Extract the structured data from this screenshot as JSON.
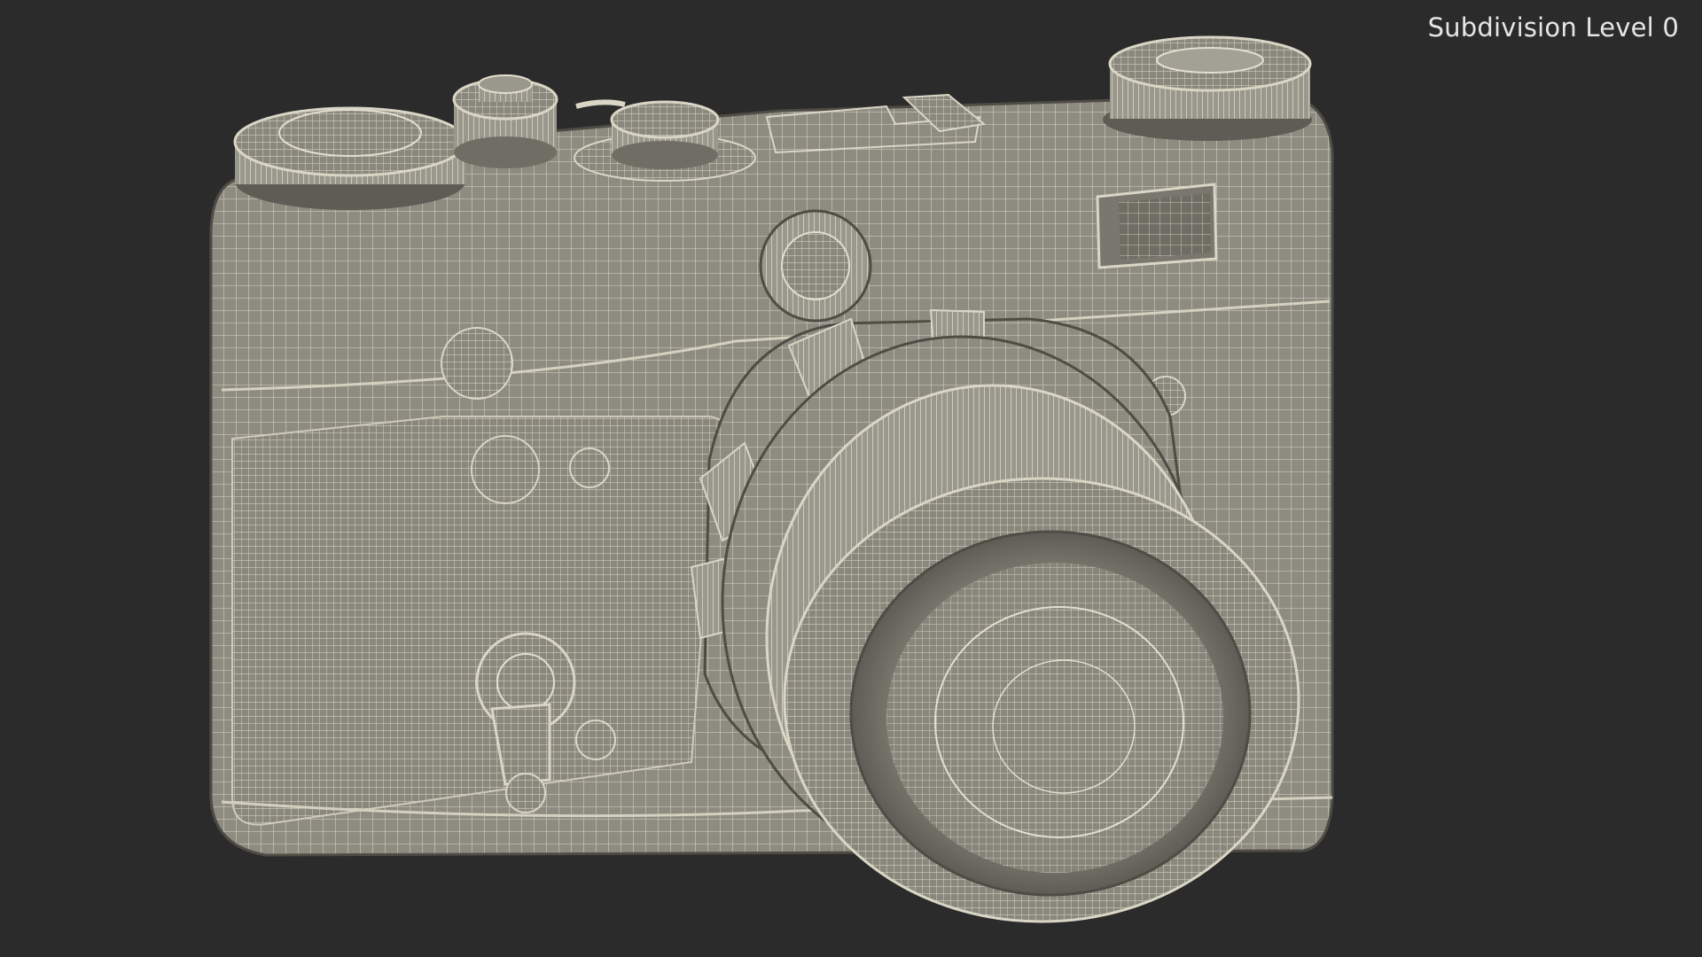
{
  "viewport": {
    "background_color": "#2b2b2b",
    "overlay_label": "Subdivision Level 0"
  },
  "model": {
    "subject": "camera-wireframe",
    "surface_color": "#8a887d",
    "wire_color": "#d9d6c6",
    "shadow_color": "#5e5c54"
  }
}
